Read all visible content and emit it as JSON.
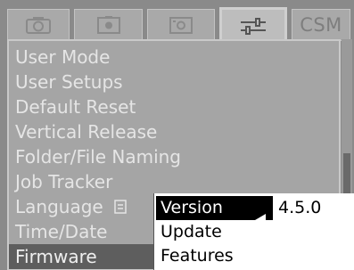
{
  "tabs": [
    {
      "icon": "camera-icon"
    },
    {
      "icon": "camera-settings-icon"
    },
    {
      "icon": "image-settings-icon"
    },
    {
      "icon": "tools-icon"
    },
    {
      "label": "CSM"
    }
  ],
  "menu": {
    "items": [
      {
        "label": "User Mode"
      },
      {
        "label": "User Setups"
      },
      {
        "label": "Default Reset"
      },
      {
        "label": "Vertical Release"
      },
      {
        "label": "Folder/File Naming"
      },
      {
        "label": "Job Tracker"
      },
      {
        "label": "Language"
      },
      {
        "label": "Time/Date"
      },
      {
        "label": "Firmware"
      }
    ],
    "selected": "Firmware"
  },
  "submenu": {
    "items": [
      {
        "label": "Version"
      },
      {
        "label": "Update"
      },
      {
        "label": "Features"
      }
    ],
    "selected": "Version",
    "version_value": "4.5.0"
  },
  "colors": {
    "menu_text": "#e5e5e5",
    "selected_bg": "#5e5e5e",
    "submenu_bg": "#ffffff"
  }
}
